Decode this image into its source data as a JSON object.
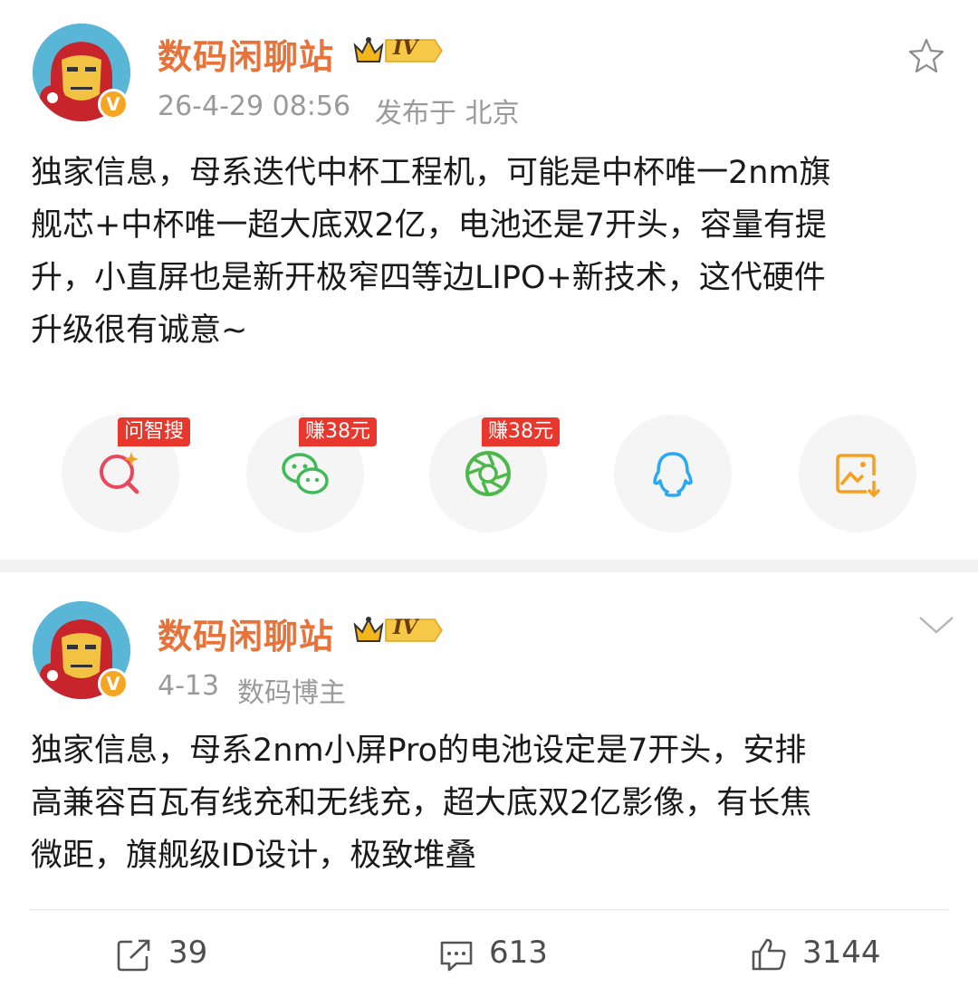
{
  "post1": {
    "author": "数码闲聊站",
    "level_badge": "IV",
    "timestamp": "26-4-29 08:56",
    "location": "发布于 北京",
    "verified_mark": "V",
    "lines": [
      "独家信息，母系迭代中杯工程机，可能是中杯唯一2nm旗",
      "舰芯+中杯唯一超大底双2亿，电池还是7开头，容量有提",
      "升，小直屏也是新开极窄四等边LIPO+新技术，这代硬件",
      "升级很有诚意~"
    ],
    "favorite_icon": "star-icon"
  },
  "share": {
    "items": [
      {
        "icon": "ai-search-icon",
        "tag": "问智搜",
        "color": "#e8475c"
      },
      {
        "icon": "wechat-icon",
        "tag": "赚38元",
        "color": "#3dbb57"
      },
      {
        "icon": "moments-icon",
        "tag": "赚38元",
        "color": "#4db84a"
      },
      {
        "icon": "qq-icon",
        "tag": "",
        "color": "#2aa8f2"
      },
      {
        "icon": "save-image-icon",
        "tag": "",
        "color": "#f5a020"
      }
    ]
  },
  "post2": {
    "author": "数码闲聊站",
    "level_badge": "IV",
    "date": "4-13",
    "role": "数码博主",
    "verified_mark": "V",
    "lines": [
      "独家信息，母系2nm小屏Pro的电池设定是7开头，安排",
      "高兼容百瓦有线充和无线充，超大底双2亿影像，有长焦",
      "微距，旗舰级ID设计，极致堆叠"
    ],
    "menu_icon": "chevron-down-icon"
  },
  "actions": {
    "repost_count": "39",
    "comment_count": "613",
    "like_count": "3144"
  }
}
